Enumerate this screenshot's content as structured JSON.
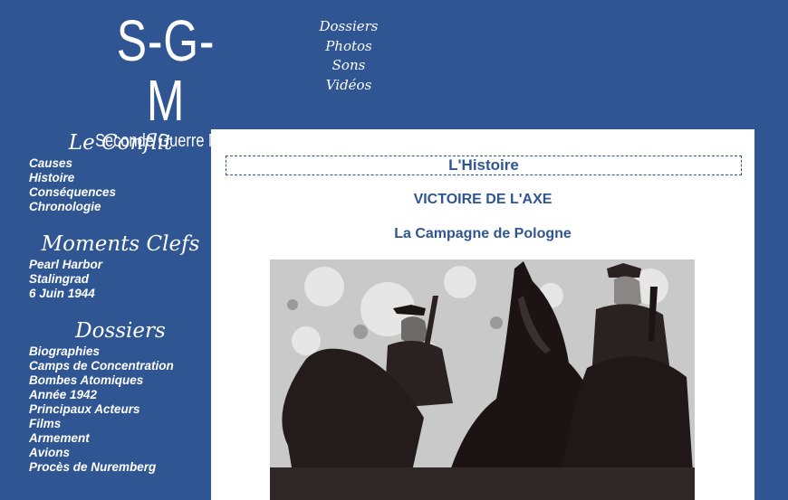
{
  "logo": {
    "title": "S-G-M",
    "subtitle": "Seconde Guerre Mondiale"
  },
  "topnav": [
    "Dossiers",
    "Photos",
    "Sons",
    "Vidéos"
  ],
  "sidebar": {
    "sections": [
      {
        "title": "Le Conflit",
        "links": [
          "Causes",
          "Histoire",
          "Conséquences",
          "Chronologie"
        ]
      },
      {
        "title": "Moments Clefs",
        "links": [
          "Pearl Harbor",
          "Stalingrad",
          "6 Juin 1944"
        ]
      },
      {
        "title": "Dossiers",
        "links": [
          "Biographies",
          "Camps de Concentration",
          "Bombes Atomiques",
          "Année 1942",
          "Principaux Acteurs",
          "Films",
          "Armement",
          "Avions",
          "Procès de Nuremberg"
        ]
      }
    ]
  },
  "main": {
    "page_heading": "L'Histoire",
    "section_heading": "VICTOIRE DE L'AXE",
    "subsection_heading": "La Campagne de Pologne"
  },
  "colors": {
    "background": "#2f5593",
    "content": "#ffffff",
    "accent": "#2f5593"
  }
}
